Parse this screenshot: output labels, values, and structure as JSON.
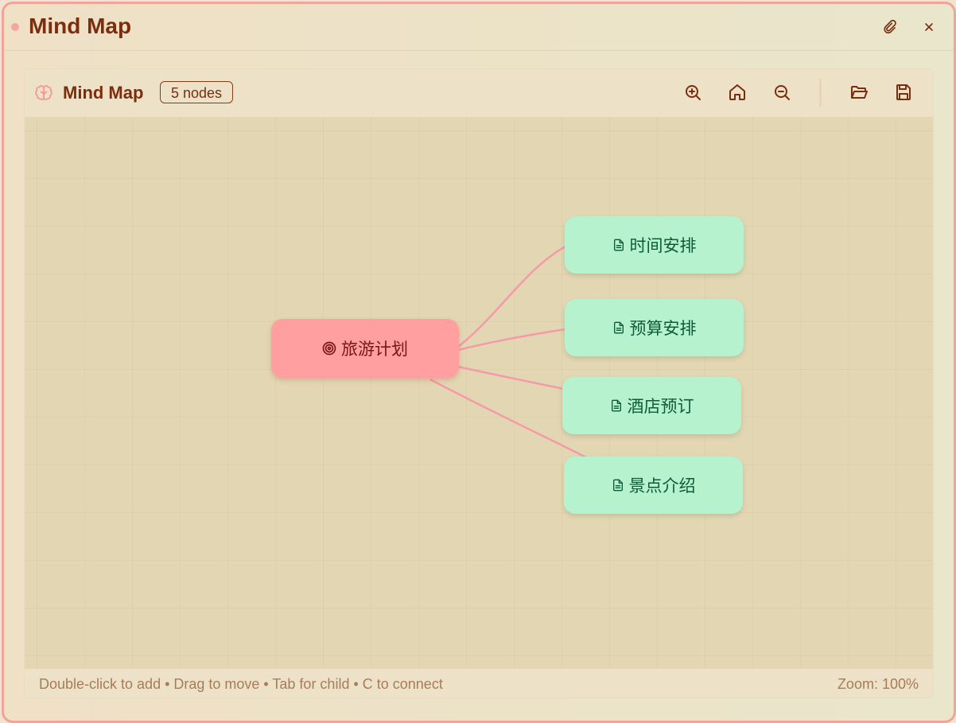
{
  "window": {
    "title": "Mind Map"
  },
  "toolbar": {
    "title": "Mind Map",
    "node_count": "5 nodes"
  },
  "icons": {
    "brain": "brain-icon",
    "zoom_in": "zoom-in-icon",
    "home": "home-icon",
    "zoom_out": "zoom-out-icon",
    "open": "folder-open-icon",
    "save": "save-icon",
    "pin": "paperclip-icon",
    "close": "close-icon"
  },
  "mindmap": {
    "root": {
      "label": "旅游计划",
      "icon": "target-icon"
    },
    "children": [
      {
        "label": "时间安排",
        "icon": "file-text-icon"
      },
      {
        "label": "预算安排",
        "icon": "file-text-icon"
      },
      {
        "label": "酒店预订",
        "icon": "file-text-icon"
      },
      {
        "label": "景点介绍",
        "icon": "file-text-icon"
      }
    ]
  },
  "status": {
    "hint": "Double-click to add • Drag to move • Tab for child • C to connect",
    "zoom": "Zoom: 100%"
  },
  "colors": {
    "accent": "#7a2e0e",
    "root_node": "#ff9f9f",
    "child_node": "#b5f2cd",
    "link": "#f59aa8",
    "window_border": "#f2a39a"
  }
}
